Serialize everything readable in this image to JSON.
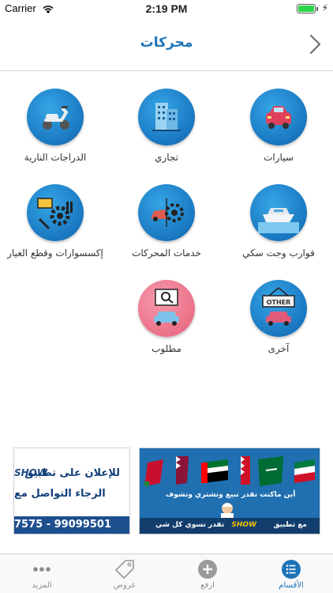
{
  "status_bar": {
    "carrier": "Carrier",
    "time": "2:19 PM"
  },
  "header": {
    "title": "محركات"
  },
  "categories": [
    {
      "label": "سيارات",
      "icon": "car-icon",
      "color": "#1a7bc4"
    },
    {
      "label": "تجاري",
      "icon": "office-building-icon",
      "color": "#1a7bc4"
    },
    {
      "label": "الدراجات النارية",
      "icon": "scooter-icon",
      "color": "#1a7bc4"
    },
    {
      "label": "قوارب وجت سكي",
      "icon": "boat-icon",
      "color": "#1a7bc4"
    },
    {
      "label": "خدمات المحركات",
      "icon": "engine-service-icon",
      "color": "#1a7bc4"
    },
    {
      "label": "إكسسوارات وقطع الغيار",
      "icon": "spare-parts-icon",
      "color": "#1a7bc4"
    },
    {
      "label": "آخرى",
      "icon": "other-sign-icon",
      "color": "#1a7bc4",
      "sign_text": "OTHER"
    },
    {
      "label": "مطلوب",
      "icon": "wanted-search-icon",
      "color": "#ec7089"
    }
  ],
  "banners": {
    "right": {
      "line1": "أين ماكنت تقدر تبيع وتشتري وتشوف",
      "footer_right": "مع تطبيق",
      "footer_logo": "SHOW",
      "footer_left": "تقدر تسوي كل شي"
    },
    "left": {
      "brand": "SHOW",
      "line1": "للإعلان على تطبيق",
      "line2": "الرجاء التواصل مع",
      "phone": "7575 - 99099501"
    }
  },
  "tabs": [
    {
      "label": "الأقسام",
      "icon": "list-icon",
      "active": true
    },
    {
      "label": "ارفع",
      "icon": "plus-circle-icon",
      "active": false
    },
    {
      "label": "عروض",
      "icon": "tag-icon",
      "active": false
    },
    {
      "label": "المزيد",
      "icon": "more-dots-icon",
      "active": false
    }
  ]
}
